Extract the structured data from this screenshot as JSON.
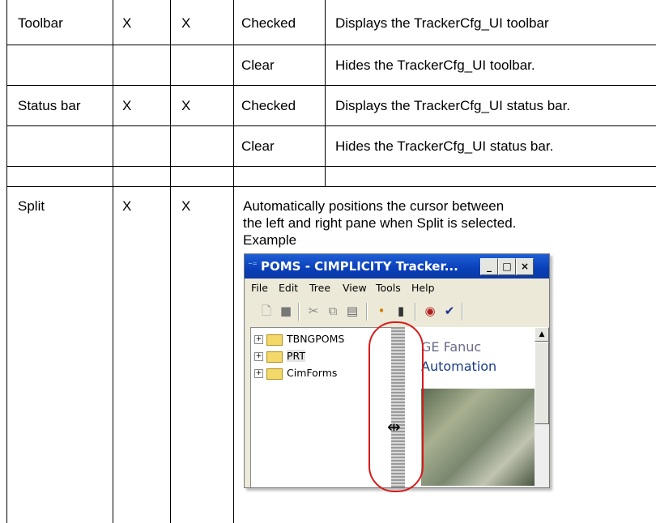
{
  "rows": [
    {
      "name": "Toolbar",
      "col2": "X",
      "col3": "X",
      "setting": "Checked",
      "description": "Displays the TrackerCfg_UI toolbar"
    },
    {
      "name": "",
      "col2": "",
      "col3": "",
      "setting": "Clear",
      "description": "Hides the TrackerCfg_UI toolbar."
    },
    {
      "name": "Status bar",
      "col2": "X",
      "col3": "X",
      "setting": "Checked",
      "description": "Displays the TrackerCfg_UI status bar."
    },
    {
      "name": "",
      "col2": "",
      "col3": "",
      "setting": "Clear",
      "description": "Hides the TrackerCfg_UI status bar."
    },
    {
      "name": "Split",
      "col2": "X",
      "col3": "X"
    }
  ],
  "split": {
    "line1": "Automatically positions the cursor between",
    "line2": "the left and right pane when Split is selected.",
    "example": "Example"
  },
  "screenshot": {
    "title": "POMS - CIMPLICITY Tracker...",
    "menu": [
      "File",
      "Edit",
      "Tree",
      "View",
      "Tools",
      "Help"
    ],
    "tree": [
      "TBNGPOMS",
      "PRT",
      "CimForms"
    ],
    "right_line1": "GE Fanuc",
    "right_line2": "Automation",
    "window_buttons": [
      "_",
      "□",
      "×"
    ],
    "toolbar_icons": [
      "new-icon",
      "save-icon",
      "cut-icon",
      "copy-icon",
      "paste-icon",
      "wand-icon",
      "properties-icon",
      "book-icon",
      "check-icon"
    ],
    "highlight_color": "#d61a1a",
    "titlebar_color": "#0a3fb8"
  }
}
